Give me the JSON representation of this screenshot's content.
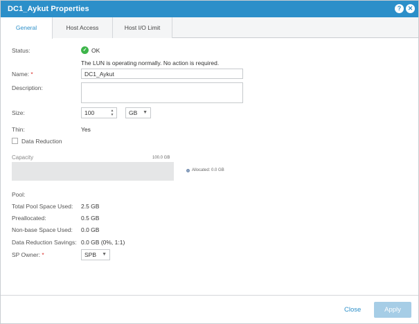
{
  "window": {
    "title": "DC1_Aykut Properties",
    "help_icon": "question-mark-icon",
    "close_icon": "close-icon"
  },
  "tabs": [
    {
      "label": "General",
      "active": true
    },
    {
      "label": "Host Access",
      "active": false
    },
    {
      "label": "Host I/O Limit",
      "active": false
    }
  ],
  "general": {
    "status_label": "Status:",
    "status_value": "OK",
    "status_message": "The LUN is operating normally. No action is required.",
    "name_label": "Name:",
    "required_marker": "*",
    "name_value": "DC1_Aykut",
    "description_label": "Description:",
    "description_value": "",
    "size_label": "Size:",
    "size_value": "100",
    "size_unit": "GB",
    "thin_label": "Thin:",
    "thin_value": "Yes",
    "data_reduction_label": "Data Reduction",
    "data_reduction_checked": false,
    "capacity_label": "Capacity",
    "capacity_max": "100.0 GB",
    "capacity_allocated_fraction": 0.0,
    "capacity_legend": "Allocated: 0.0 GB",
    "pool_label": "Pool:",
    "pool_value": "",
    "total_pool_label": "Total Pool Space Used:",
    "total_pool_value": "2.5 GB",
    "preallocated_label": "Preallocated:",
    "preallocated_value": "0.5 GB",
    "nonbase_label": "Non-base Space Used:",
    "nonbase_value": "0.0 GB",
    "dr_savings_label": "Data Reduction Savings:",
    "dr_savings_value": "0.0 GB (0%, 1:1)",
    "sp_owner_label": "SP Owner:",
    "sp_owner_value": "SPB"
  },
  "footer": {
    "close_label": "Close",
    "apply_label": "Apply"
  },
  "colors": {
    "titlebar": "#2c8fc9",
    "ok_status": "#3db54a",
    "required": "#d9302c",
    "apply_disabled": "#a6cde6"
  }
}
